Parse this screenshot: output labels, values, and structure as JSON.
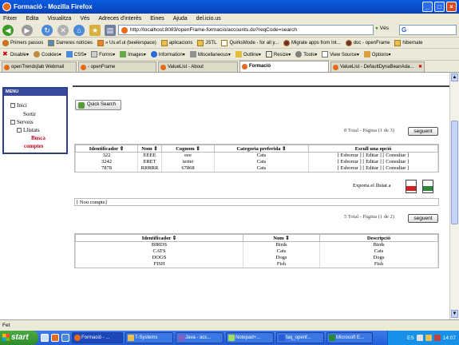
{
  "window": {
    "title": "Formació - Mozilla Firefox"
  },
  "menubar": {
    "items": [
      "Fitxer",
      "Edita",
      "Visualitza",
      "Vés",
      "Adreces d'interès",
      "Eines",
      "Ajuda",
      "del.icio.us"
    ]
  },
  "navbar": {
    "url": "http://localhost:8083/openFrame-formacio/accounts.do?reqCode=search",
    "go_label": "Vés",
    "search_placeholder": ""
  },
  "bookmarks": [
    "Primers passos",
    "Darreres notícies",
    "» Us.ef.ul (beelerspace)",
    "aplicacions",
    "JSTL",
    "QuirksMode - for all y...",
    "Migrate apps from Int...",
    "doc - openFrame",
    "hibernate"
  ],
  "devbar": [
    "Disable▾",
    "Cookies▾",
    "CSS▾",
    "Forms▾",
    "Images▾",
    "Information▾",
    "Miscellaneous▾",
    "Outline▾",
    "Resize▾",
    "Tools▾",
    "View Source▾",
    "Options▾"
  ],
  "tabs": [
    {
      "label": "openTrends|lab Webmail",
      "active": false
    },
    {
      "label": "- openFrame",
      "active": false
    },
    {
      "label": "ValueList - About",
      "active": false
    },
    {
      "label": "Formació",
      "active": true
    },
    {
      "label": "ValueList - DefaultDynaBeanAda...",
      "active": false
    }
  ],
  "sidemenu": {
    "header": "MENU",
    "inici": "Inici",
    "sortir": "Sortir",
    "serveis": "Serveis",
    "llistats": "Llistats",
    "busca1": "Busca",
    "busca2": "comptes"
  },
  "quick_search": {
    "label": "Quick Search"
  },
  "pager1": {
    "text": "8 Total - Pàgina (1 de 3)",
    "next": "seguent"
  },
  "table1": {
    "headers": [
      "Identificador ⇕",
      "Nom ⇕",
      "Cognom ⇕",
      "Categoria preferida ⇕",
      "Escull una opció"
    ],
    "rows": [
      [
        "322",
        "EEEE",
        "eee",
        "Cats",
        "[ Esborrar ] [ Editar ] [ Consultar ]"
      ],
      [
        "3242",
        "ERET",
        "tertet",
        "Cats",
        "[ Esborrar ] [ Editar ] [ Consultar ]"
      ],
      [
        "7878",
        "RRRRR",
        "67868",
        "Cats",
        "[ Esborrar ] [ Editar ] [ Consultar ]"
      ]
    ]
  },
  "export": {
    "label": "Exporta el llistat a",
    "pdf_icon": "pdf-icon",
    "excel_icon": "excel-icon"
  },
  "new_account": {
    "label": "[ Nou compte]"
  },
  "pager2": {
    "text": "5 Total - Pàgina (1 de 2)",
    "next": "seguent"
  },
  "table2": {
    "headers": [
      "Identificador ⇕",
      "Nom ⇕",
      "Descripció"
    ],
    "rows": [
      [
        "BIRDS",
        "Birds",
        "Birds"
      ],
      [
        "CATS",
        "Cats",
        "Cats"
      ],
      [
        "DOGS",
        "Dogs",
        "Dogs"
      ],
      [
        "FISH",
        "Fish",
        "Fish"
      ]
    ]
  },
  "status": {
    "text": "Fet"
  },
  "taskbar": {
    "start": "start",
    "tasks": [
      {
        "label": "Formació - ...",
        "active": true
      },
      {
        "label": "T-Systems",
        "active": false
      },
      {
        "label": "Java - acc...",
        "active": false
      },
      {
        "label": "Notepad+...",
        "active": false
      },
      {
        "label": "faq_openf...",
        "active": false
      },
      {
        "label": "Microsoft E...",
        "active": false
      }
    ],
    "lang": "ES",
    "clock": "14:07"
  },
  "colors": {
    "titlebar": "#0a5be0",
    "menu_border": "#2e3d8c",
    "busca_red": "#d0001a",
    "taskbar": "#245ed8"
  }
}
